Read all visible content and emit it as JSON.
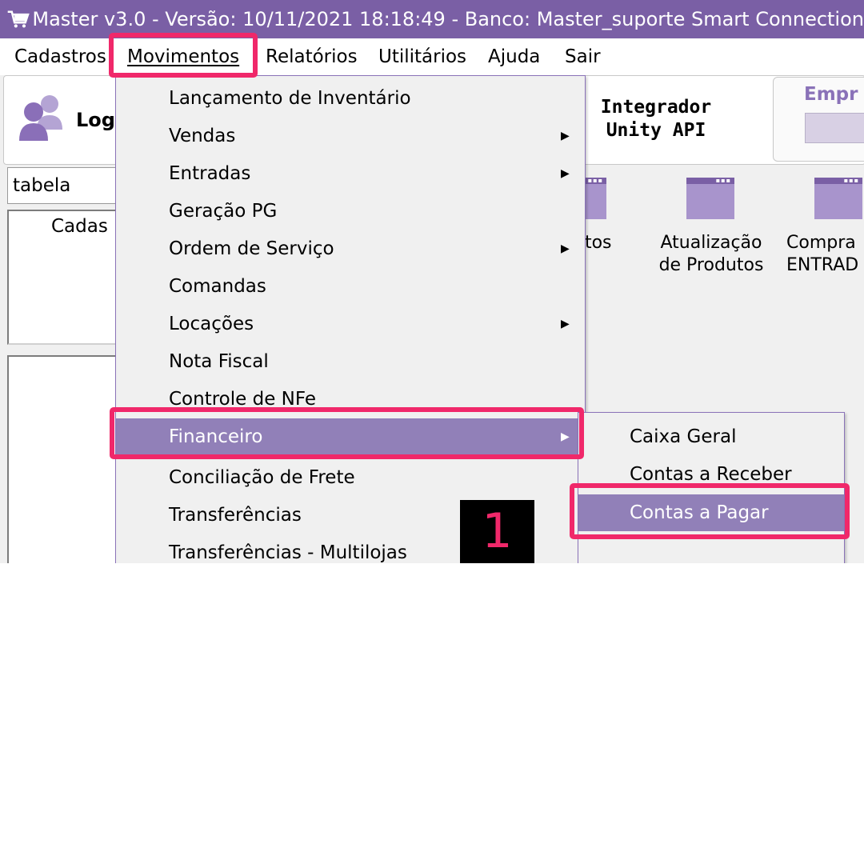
{
  "window": {
    "title": "Master  v3.0 -  Versão: 10/11/2021 18:18:49 - Banco: Master_suporte Smart Connection"
  },
  "menubar": {
    "items": [
      "Cadastros",
      "Movimentos",
      "Relatórios",
      "Utilitários",
      "Ajuda",
      "Sair"
    ],
    "active": "Movimentos"
  },
  "toolbar": {
    "login_label": "Log",
    "integrador_line1": "Integrador",
    "integrador_line2": "Unity API",
    "empresa_label": "Empr"
  },
  "sidebar": {
    "search_value": "tabela",
    "tree_item": "Cadas"
  },
  "shortcuts": [
    {
      "line1": "utos",
      "line2": ""
    },
    {
      "line1": "Atualização",
      "line2": "de Produtos"
    },
    {
      "line1": "Compra",
      "line2": "ENTRAD"
    }
  ],
  "dropdown": {
    "items": [
      {
        "label": "Lançamento de Inventário",
        "submenu": false
      },
      {
        "label": "Vendas",
        "submenu": true
      },
      {
        "label": "Entradas",
        "submenu": true
      },
      {
        "label": "Geração PG",
        "submenu": false
      },
      {
        "label": "Ordem de Serviço",
        "submenu": true
      },
      {
        "label": "Comandas",
        "submenu": false
      },
      {
        "label": "Locações",
        "submenu": true
      },
      {
        "label": "Nota Fiscal",
        "submenu": false
      },
      {
        "label": "Controle de NFe",
        "submenu": false
      },
      {
        "label": "Financeiro",
        "submenu": true,
        "highlighted": true
      },
      {
        "label": "Conciliação de Frete",
        "submenu": false
      },
      {
        "label": "Transferências",
        "submenu": false
      },
      {
        "label": "Transferências - Multilojas",
        "submenu": false
      }
    ]
  },
  "submenu": {
    "items": [
      {
        "label": "Caixa Geral"
      },
      {
        "label": "Contas a Receber"
      },
      {
        "label": "Contas a Pagar",
        "highlighted": true
      }
    ]
  },
  "annotation": {
    "step_number": "1"
  },
  "colors": {
    "titlebar": "#7a5fa5",
    "menu_highlight": "#9180b8",
    "annotation": "#f0286a"
  }
}
